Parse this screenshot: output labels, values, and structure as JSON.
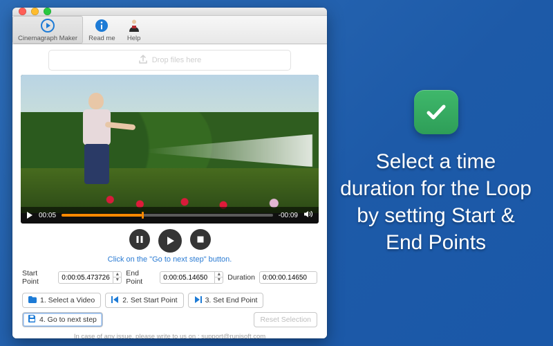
{
  "toolbar": {
    "items": [
      {
        "label": "Cinemagraph Maker",
        "icon": "play-circle"
      },
      {
        "label": "Read me",
        "icon": "info-circle"
      },
      {
        "label": "Help",
        "icon": "help-person"
      }
    ]
  },
  "dropzone": {
    "label": "Drop files here"
  },
  "video": {
    "current_time": "00:05",
    "remaining_time": "-00:09"
  },
  "hint": "Click on the \"Go to next step\" button.",
  "time": {
    "start_label": "Start Point",
    "start_value": "0:00:05.473726",
    "end_label": "End Point",
    "end_value": "0:00:05.14650",
    "duration_label": "Duration",
    "duration_value": "0:00:00.14650"
  },
  "steps": {
    "s1": "1. Select a Video",
    "s2": "2. Set Start Point",
    "s3": "3. Set End Point",
    "s4": "4. Go to next step",
    "reset": "Reset Selection"
  },
  "footer": "In case of any issue, please write to us on : support@runisoft.com",
  "promo": {
    "text": "Select a time duration for the Loop by setting Start & End Points"
  }
}
